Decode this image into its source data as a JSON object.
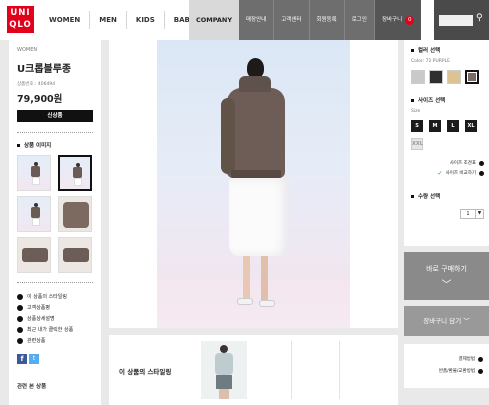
{
  "header": {
    "logo_line1": "UNI",
    "logo_line2": "QLO",
    "nav": [
      "WOMEN",
      "MEN",
      "KIDS",
      "BABY"
    ],
    "company": "COMPANY",
    "util": [
      "매장안내",
      "고객센터",
      "회원등록",
      "로그인"
    ],
    "cart_label": "장바구니",
    "cart_count": "0",
    "search_icon": "search-icon"
  },
  "product": {
    "gender": "WOMEN",
    "name": "U크롭블루종",
    "number": "상품번호 : 406494",
    "price": "79,900원",
    "badge": "신상품",
    "images_title": "상품 이미지"
  },
  "left_links": [
    "이 상품의 스타일링",
    "고객상품평",
    "상품상세설명",
    "최근 내가 클릭한 상품",
    "관련상품"
  ],
  "social": {
    "facebook": "f",
    "twitter": "t"
  },
  "left_cutoff": "관련 본 상품",
  "styling": {
    "title": "이 상품의 스타일링"
  },
  "options": {
    "color_title": "컬러 선택",
    "color_value": "Color: 72 PURPLE",
    "swatches": [
      "#c9c9c9",
      "#2f2f2f",
      "#dcc391",
      "#7a6a66"
    ],
    "size_title": "사이즈 선택",
    "size_value": "Size",
    "sizes": [
      "S",
      "M",
      "L",
      "XL"
    ],
    "size_disabled": "XXL",
    "size_guide": "사이즈 조견표",
    "size_compare": "사이즈 비교하기",
    "qty_title": "수량 선택",
    "qty_value": "1",
    "qty_arrow": "▼"
  },
  "actions": {
    "buy": "바로 구매하기",
    "buy_arrow": "﹀",
    "cart": "장바구니 담기 ﹀"
  },
  "info": [
    "결제방법",
    "반품/환불/교환방법"
  ],
  "colors": {
    "brand_red": "#e3001b",
    "util_bar": "#6e6e6e",
    "button_gray": "#8a8a8a"
  }
}
